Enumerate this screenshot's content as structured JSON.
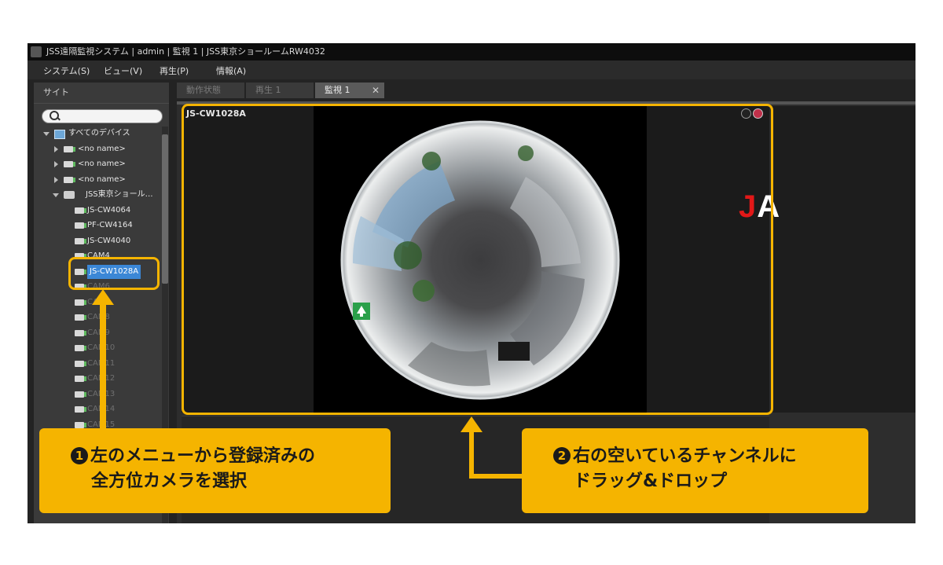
{
  "window": {
    "title": "JSS遠隔監視システム | admin | 監視 1 | JSS東京ショールームRW4032"
  },
  "menu": [
    "システム(S)",
    "ビュー(V)",
    "再生(P)",
    "情報(A)"
  ],
  "sidebar": {
    "header": "サイト",
    "search_placeholder": "",
    "tree": [
      {
        "label": "すべてのデバイス",
        "dim": false
      },
      {
        "label": "<no name>",
        "dim": false
      },
      {
        "label": "<no name>",
        "dim": false
      },
      {
        "label": "<no name>",
        "dim": false
      },
      {
        "label": "JSS東京ショール…",
        "dim": false
      },
      {
        "label": "JS-CW4064",
        "dim": false
      },
      {
        "label": "PF-CW4164",
        "dim": false
      },
      {
        "label": "JS-CW4040",
        "dim": false
      },
      {
        "label": "CAM4",
        "dim": false
      },
      {
        "label": "JS-CW1028A",
        "dim": false,
        "selected": true
      },
      {
        "label": "CAM6",
        "dim": true
      },
      {
        "label": "CAM7",
        "dim": true
      },
      {
        "label": "CAM8",
        "dim": true
      },
      {
        "label": "CAM9",
        "dim": true
      },
      {
        "label": "CAM10",
        "dim": true
      },
      {
        "label": "CAM11",
        "dim": true
      },
      {
        "label": "CAM12",
        "dim": true
      },
      {
        "label": "CAM13",
        "dim": true
      },
      {
        "label": "CAM14",
        "dim": true
      },
      {
        "label": "CAM15",
        "dim": true
      },
      {
        "label": "CAM21",
        "dim": true
      }
    ]
  },
  "tabs": [
    {
      "label": "動作状態",
      "active": false
    },
    {
      "label": "再生 1",
      "active": false
    },
    {
      "label": "監視 1",
      "active": true,
      "close": "✕"
    }
  ],
  "viewer": {
    "camera_label": "JS-CW1028A"
  },
  "brand": {
    "logo_text_red": "J",
    "logo_text_white": "A"
  },
  "callouts": {
    "step1": {
      "number": "1",
      "line1": "左のメニューから登録済みの",
      "line2": "全方位カメラを選択"
    },
    "step2": {
      "number": "2",
      "line1": "右の空いているチャンネルに",
      "line2": "ドラッグ&ドロップ"
    }
  },
  "colors": {
    "accent": "#f5b400",
    "selection": "#3b87d6",
    "logo_red": "#e21818"
  }
}
